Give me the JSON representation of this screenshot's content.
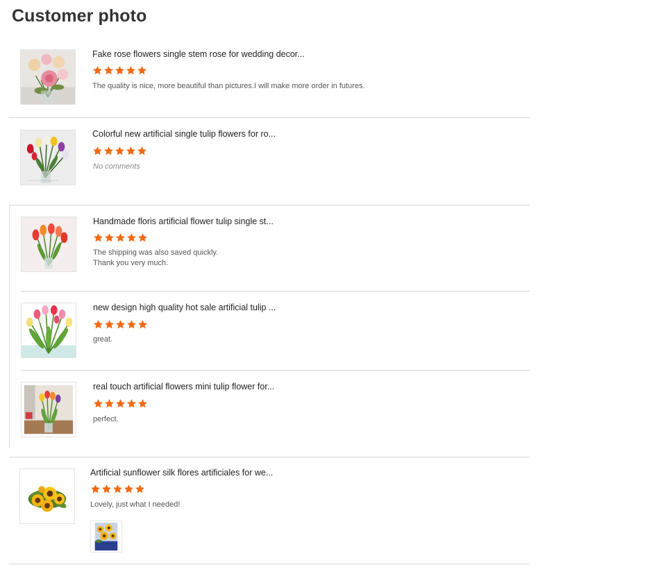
{
  "page_title": "Customer photo",
  "colors": {
    "star": "#f06a13",
    "divider": "#d6d6d6",
    "title_text": "#222222",
    "comment_text": "#555555"
  },
  "reviews": [
    {
      "product_title": "Fake rose flowers single stem rose for wedding decor...",
      "rating": 5,
      "comment": "The quality is nice, more beautiful than pictures.I will make more  order in futures.",
      "thumbnail": "pink-rose-bouquet-image"
    },
    {
      "product_title": "Colorful new artificial single tulip flowers for ro...",
      "rating": 5,
      "comment": "No comments",
      "thumbnail": "colorful-tulip-vase-image"
    },
    {
      "product_title": "Handmade floris artificial flower tulip single st...",
      "rating": 5,
      "comment_lines": [
        "The shipping was also saved quickly.",
        "Thank you very much."
      ],
      "thumbnail": "tulip-vase-image"
    },
    {
      "product_title": "new design high quality hot sale artificial tulip ...",
      "rating": 5,
      "comment": "great.",
      "thumbnail": "tulip-bouquet-image"
    },
    {
      "product_title": "real touch artificial flowers mini tulip flower for...",
      "rating": 5,
      "comment": "perfect.",
      "thumbnail": "tulip-table-image"
    },
    {
      "product_title": "Artificial sunflower silk flores artificiales for we...",
      "rating": 5,
      "comment": "Lovely, just what I needed!",
      "thumbnail": "sunflower-bouquet-image",
      "customer_photo": "sunflower-customer-photo"
    }
  ]
}
